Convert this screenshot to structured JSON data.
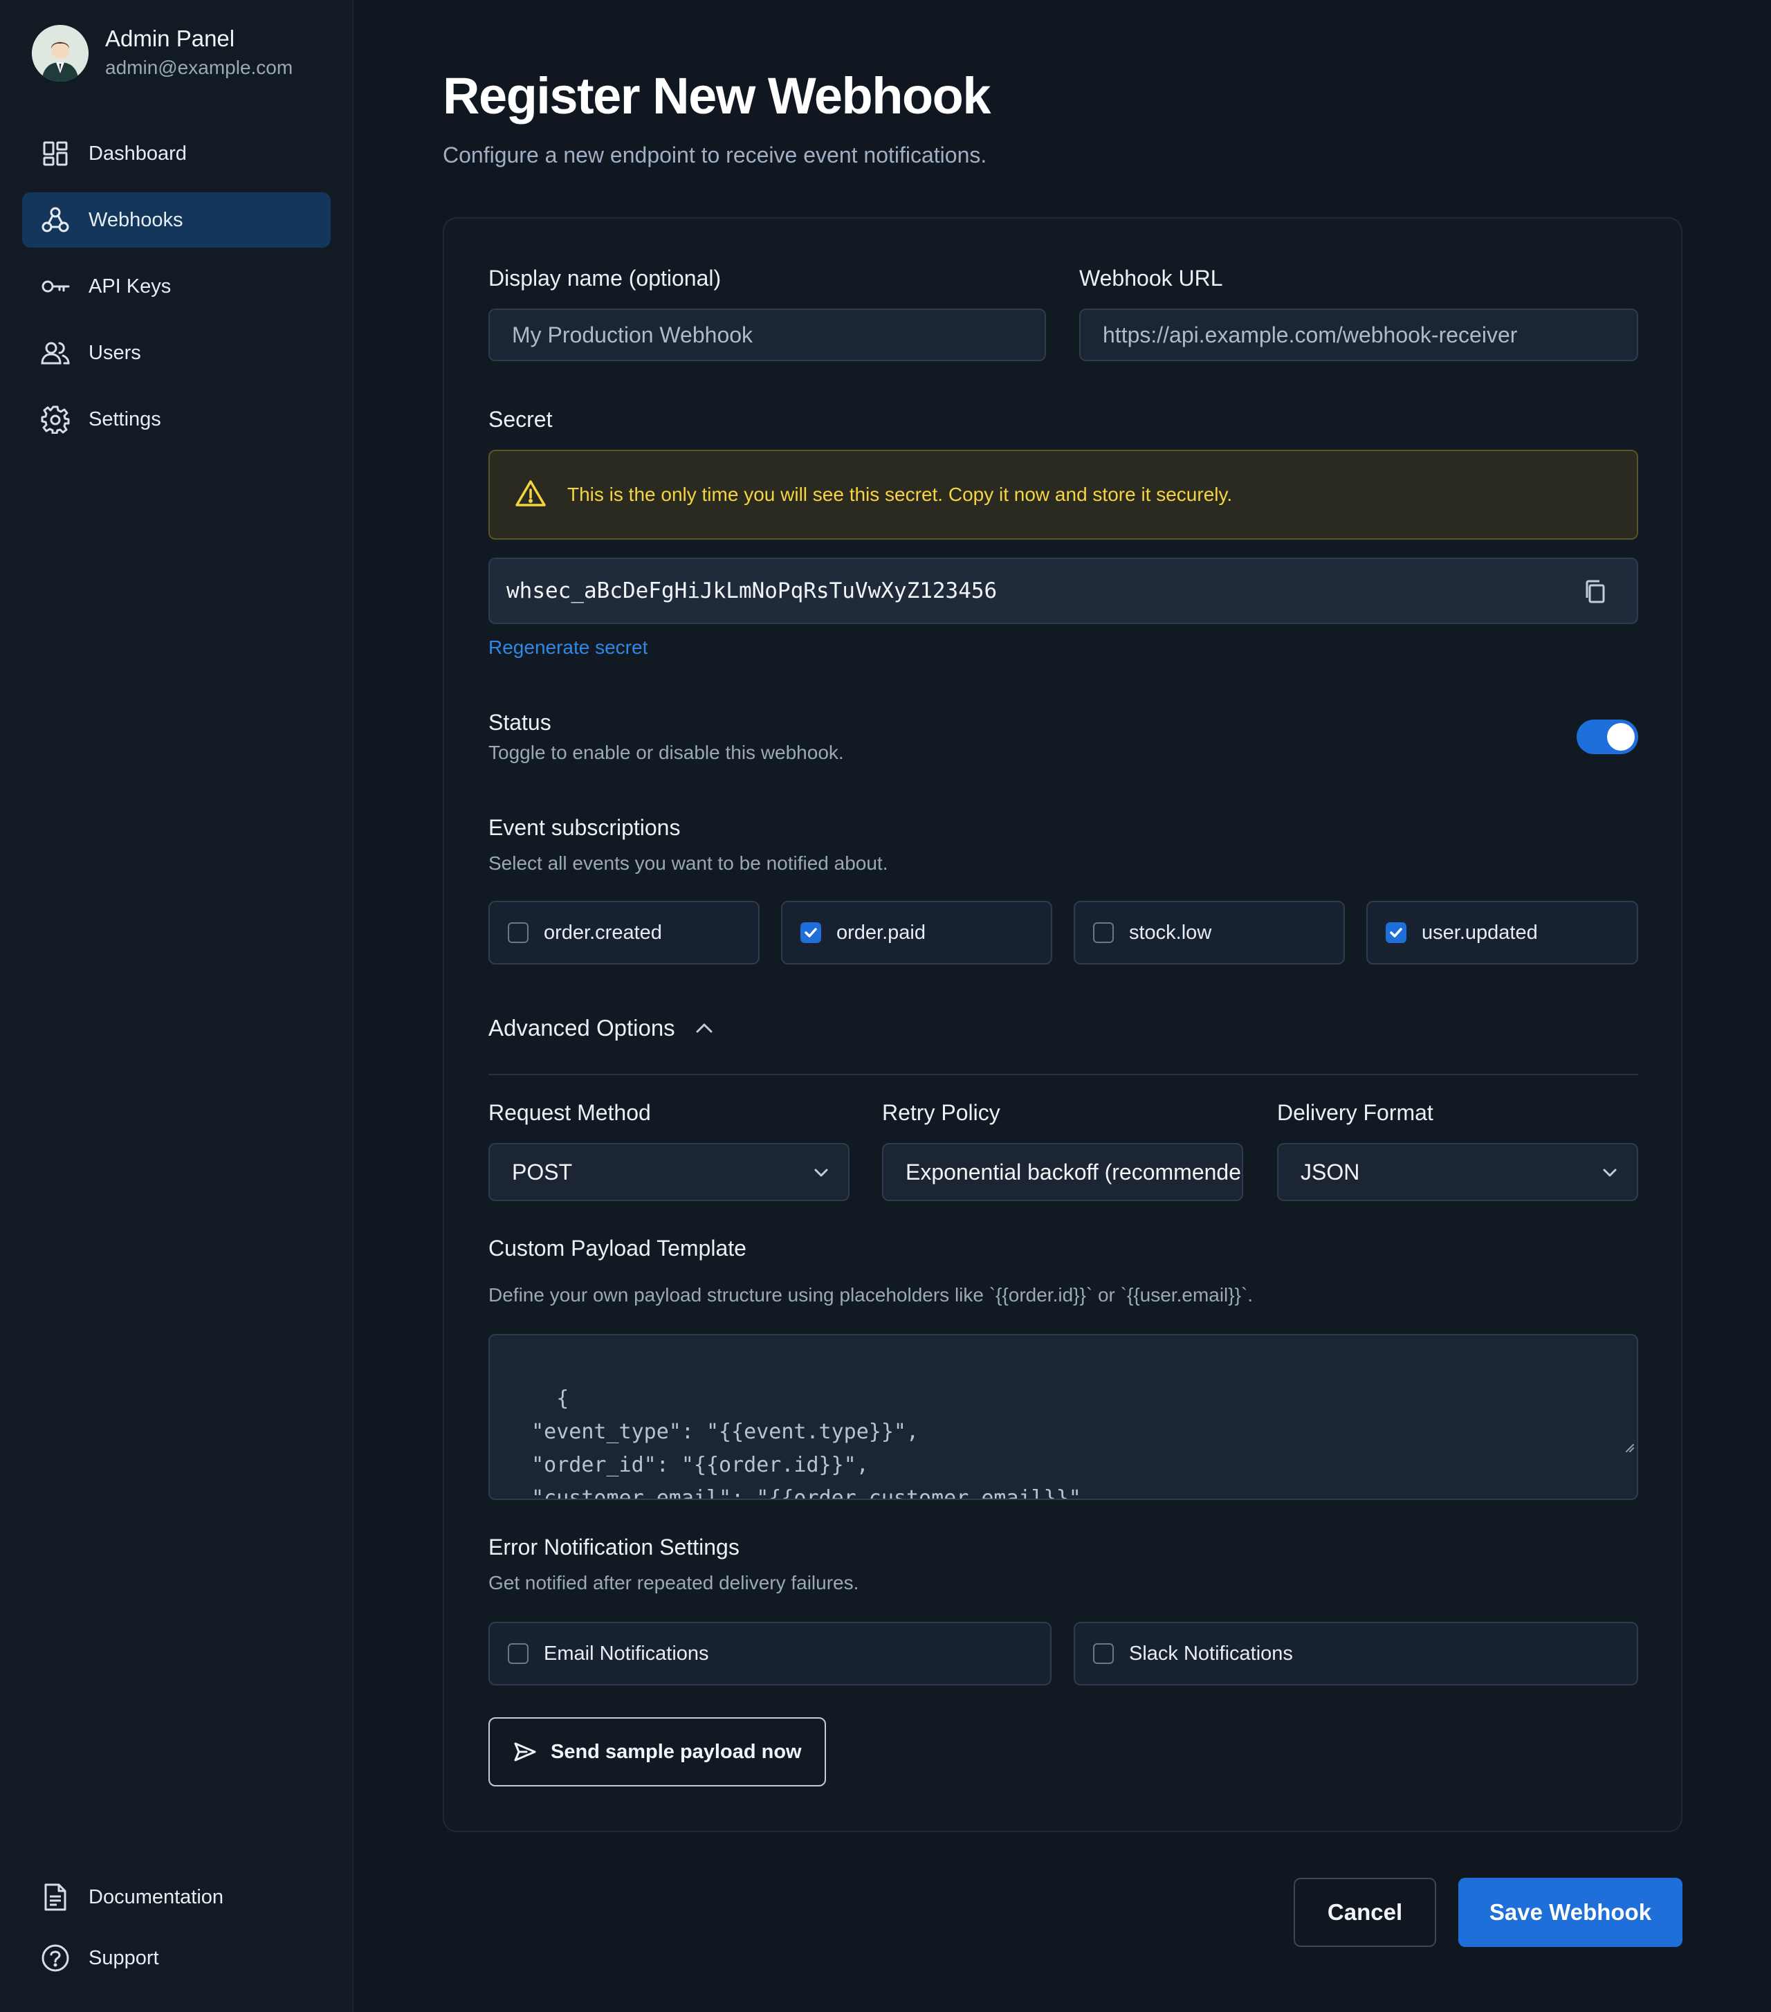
{
  "sidebar": {
    "profile": {
      "name": "Admin Panel",
      "email": "admin@example.com"
    },
    "items": [
      {
        "label": "Dashboard",
        "icon": "dashboard-icon",
        "active": false
      },
      {
        "label": "Webhooks",
        "icon": "webhook-icon",
        "active": true
      },
      {
        "label": "API Keys",
        "icon": "key-icon",
        "active": false
      },
      {
        "label": "Users",
        "icon": "users-icon",
        "active": false
      },
      {
        "label": "Settings",
        "icon": "gear-icon",
        "active": false
      }
    ],
    "bottom_items": [
      {
        "label": "Documentation",
        "icon": "document-icon"
      },
      {
        "label": "Support",
        "icon": "help-icon"
      }
    ]
  },
  "header": {
    "title": "Register New Webhook",
    "subtitle": "Configure a new endpoint to receive event notifications."
  },
  "form": {
    "display_name": {
      "label": "Display name (optional)",
      "placeholder": "My Production Webhook"
    },
    "url": {
      "label": "Webhook URL",
      "placeholder": "https://api.example.com/webhook-receiver"
    },
    "secret": {
      "label": "Secret",
      "warning": "This is the only time you will see this secret. Copy it now and store it securely.",
      "value": "whsec_aBcDeFgHiJkLmNoPqRsTuVwXyZ123456",
      "regenerate_label": "Regenerate secret"
    },
    "status": {
      "label": "Status",
      "help": "Toggle to enable or disable this webhook.",
      "enabled": true
    },
    "events": {
      "label": "Event subscriptions",
      "help": "Select all events you want to be notified about.",
      "items": [
        {
          "label": "order.created",
          "checked": false
        },
        {
          "label": "order.paid",
          "checked": true
        },
        {
          "label": "stock.low",
          "checked": false
        },
        {
          "label": "user.updated",
          "checked": true
        }
      ]
    },
    "advanced": {
      "label": "Advanced Options",
      "expanded": true,
      "request_method": {
        "label": "Request Method",
        "value": "POST"
      },
      "retry_policy": {
        "label": "Retry Policy",
        "value": "Exponential backoff (recommended)"
      },
      "delivery_format": {
        "label": "Delivery Format",
        "value": "JSON"
      },
      "payload": {
        "label": "Custom Payload Template",
        "help": "Define your own payload structure using placeholders like `{{order.id}}` or `{{user.email}}`.",
        "value": "{\n  \"event_type\": \"{{event.type}}\",\n  \"order_id\": \"{{order.id}}\",\n  \"customer_email\": \"{{order.customer.email}}\"\n}"
      },
      "error_notifications": {
        "label": "Error Notification Settings",
        "help": "Get notified after repeated delivery failures.",
        "items": [
          {
            "label": "Email Notifications",
            "checked": false
          },
          {
            "label": "Slack Notifications",
            "checked": false
          }
        ]
      },
      "send_sample_label": "Send sample payload now"
    }
  },
  "actions": {
    "cancel_label": "Cancel",
    "save_label": "Save Webhook"
  },
  "colors": {
    "accent": "#1e6fd9",
    "warning": "#f5d442",
    "background": "#101720"
  }
}
